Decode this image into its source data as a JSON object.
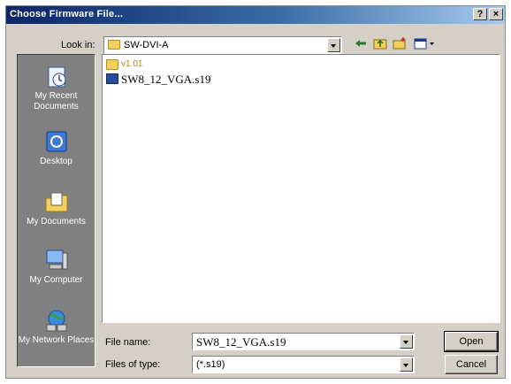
{
  "window": {
    "title": "Choose Firmware File...",
    "help_glyph": "?",
    "close_glyph": "×"
  },
  "lookin": {
    "label": "Look in:",
    "value": "SW-DVI-A"
  },
  "toolbar": {
    "icons": [
      "back-arrow-icon",
      "up-folder-icon",
      "new-folder-icon",
      "view-menu-icon"
    ]
  },
  "places": [
    {
      "label": "My Recent Documents",
      "icon": "recent-documents-icon"
    },
    {
      "label": "Desktop",
      "icon": "desktop-icon"
    },
    {
      "label": "My Documents",
      "icon": "my-documents-icon"
    },
    {
      "label": "My Computer",
      "icon": "my-computer-icon"
    },
    {
      "label": "My Network Places",
      "icon": "network-places-icon"
    }
  ],
  "files": [
    {
      "name": "v1.01",
      "type": "folder"
    },
    {
      "name": "SW8_12_VGA.s19",
      "type": "file"
    }
  ],
  "filename": {
    "label": "File name:",
    "value": "SW8_12_VGA.s19"
  },
  "filetype": {
    "label": "Files of type:",
    "value": "(*.s19)"
  },
  "buttons": {
    "open": "Open",
    "cancel": "Cancel"
  },
  "colors": {
    "titlebar_start": "#0a246a",
    "titlebar_end": "#a6caf0",
    "dialog_face": "#d4d0c8",
    "places_bar": "#808080"
  }
}
